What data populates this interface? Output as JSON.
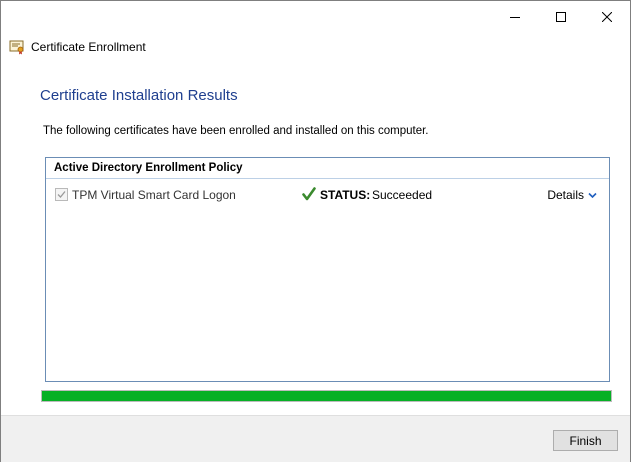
{
  "window": {
    "app_title": "Certificate Enrollment",
    "controls": {
      "minimize": "minimize-icon",
      "maximize": "maximize-icon",
      "close": "close-icon"
    }
  },
  "page": {
    "heading": "Certificate Installation Results",
    "description": "The following certificates have been enrolled and installed on this computer."
  },
  "policy": {
    "header": "Active Directory Enrollment Policy",
    "items": [
      {
        "name": "TPM Virtual Smart Card Logon",
        "checked": true,
        "status_label": "STATUS:",
        "status_value": "Succeeded",
        "details_label": "Details"
      }
    ]
  },
  "progress": {
    "percent": 100,
    "color": "#06b025"
  },
  "footer": {
    "finish_label": "Finish"
  },
  "colors": {
    "heading": "#1f3f8f",
    "success": "#2e7d32",
    "accent": "#1f5fbf"
  }
}
